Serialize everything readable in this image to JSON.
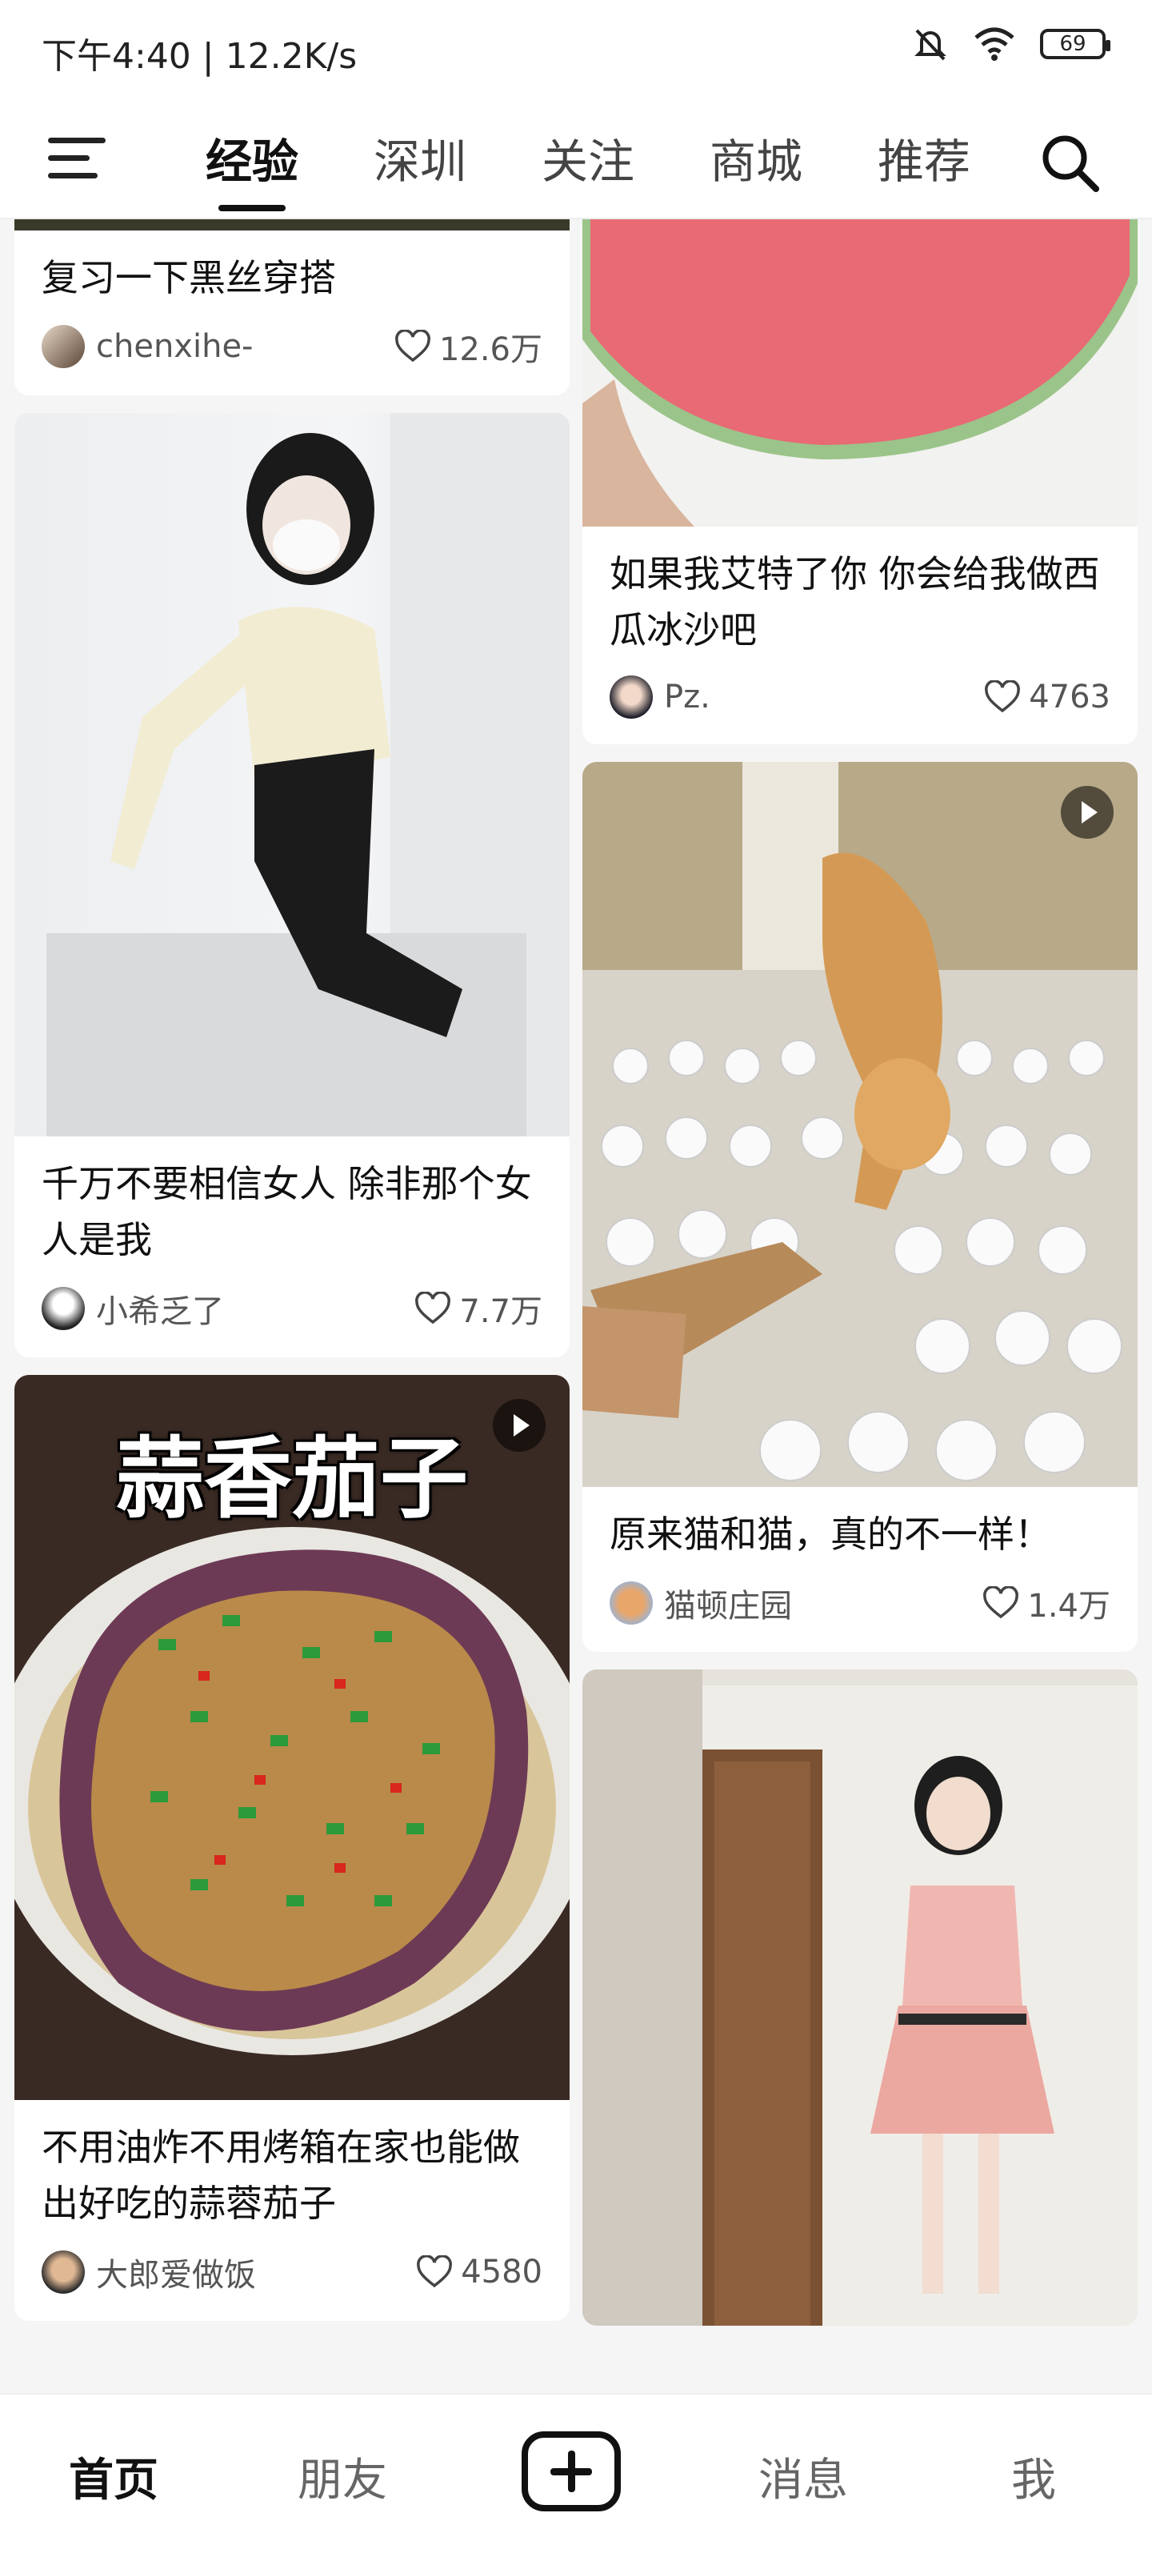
{
  "status": {
    "time": "下午4:40 | 12.2K/s",
    "battery": "69"
  },
  "tabs": [
    "经验",
    "深圳",
    "关注",
    "商城",
    "推荐"
  ],
  "active_tab": 0,
  "left_column": [
    {
      "title": "复习一下黑丝穿搭",
      "author": "chenxihe-",
      "likes": "12.6万",
      "partial_top": true
    },
    {
      "title": "千万不要相信女人 除非那个女人是我",
      "author": "小希乏了",
      "likes": "7.7万"
    },
    {
      "title": "不用油炸不用烤箱在家也能做出好吃的蒜蓉茄子",
      "author": "大郎爱做饭",
      "likes": "4580",
      "overlay": "蒜香茄子",
      "video": true
    }
  ],
  "right_column": [
    {
      "title": "如果我艾特了你 你会给我做西瓜冰沙吧",
      "author": "Pz.",
      "likes": "4763",
      "partial_top": true
    },
    {
      "title": "原来猫和猫，真的不一样！",
      "author": "猫顿庄园",
      "likes": "1.4万",
      "video": true
    },
    {
      "title": "",
      "author": "",
      "likes": ""
    }
  ],
  "bottom_nav": {
    "home": "首页",
    "friends": "朋友",
    "messages": "消息",
    "me": "我"
  },
  "colors": {
    "accent": "#111111",
    "background": "#f5f5f5"
  }
}
